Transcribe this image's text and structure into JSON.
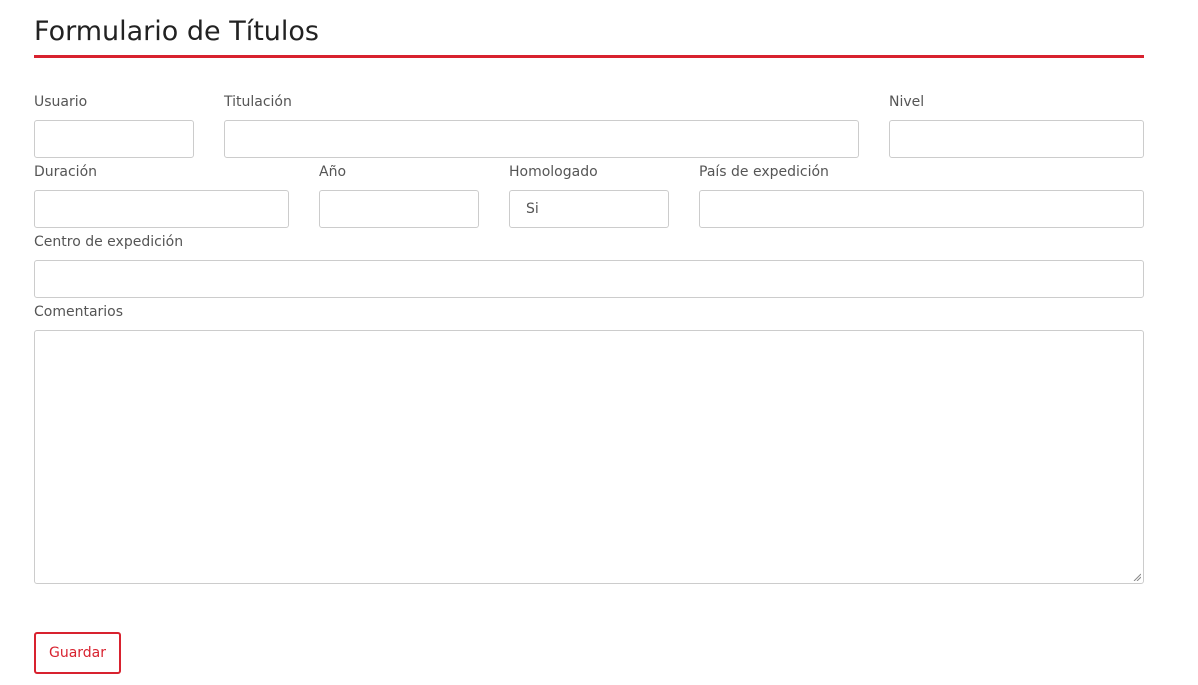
{
  "form": {
    "title": "Formulario de Títulos",
    "fields": {
      "usuario": {
        "label": "Usuario",
        "value": ""
      },
      "titulacion": {
        "label": "Titulación",
        "value": ""
      },
      "nivel": {
        "label": "Nivel",
        "value": ""
      },
      "duracion": {
        "label": "Duración",
        "value": ""
      },
      "anio": {
        "label": "Año",
        "value": ""
      },
      "homologado": {
        "label": "Homologado",
        "value": "Si"
      },
      "pais": {
        "label": "País de expedición",
        "value": ""
      },
      "centro": {
        "label": "Centro de expedición",
        "value": ""
      },
      "comentarios": {
        "label": "Comentarios",
        "value": ""
      }
    },
    "save_label": "Guardar"
  },
  "colors": {
    "accent": "#d8222f",
    "border": "#cccccc",
    "text": "#555555"
  },
  "icons": {
    "textarea_resize": "resize-grip-icon"
  }
}
